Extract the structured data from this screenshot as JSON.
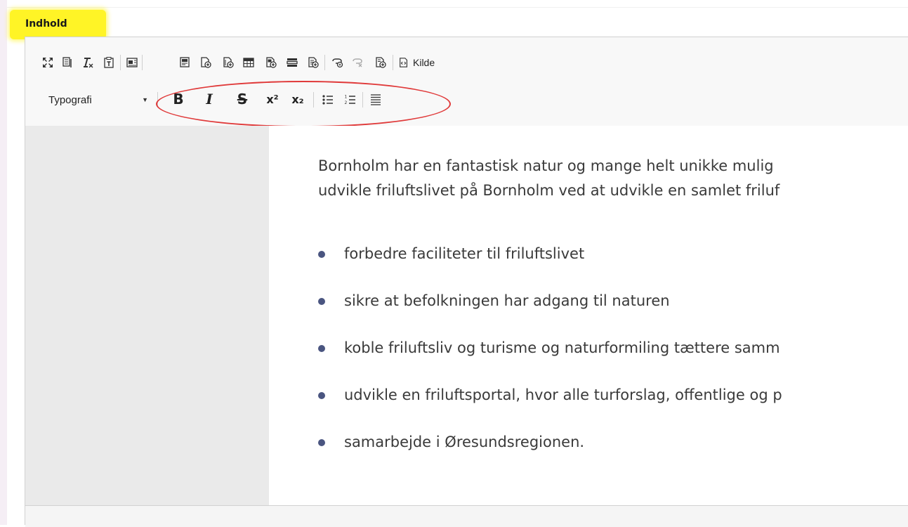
{
  "field_label": "Indhold",
  "toolbar": {
    "row1_icons": [
      "maximize-icon",
      "show-blocks-icon",
      "remove-format-icon",
      "paste-as-text-icon",
      "paste-from-word-icon",
      "insert-template-icon",
      "insert-image-icon",
      "insert-file-icon",
      "table-icon",
      "insert-media-icon",
      "horizontal-rule-icon",
      "insert-document-icon",
      "link-icon",
      "unlink-icon",
      "anchor-icon"
    ],
    "source_label": "Kilde",
    "format_combo": {
      "label": "Typografi"
    },
    "format_buttons": [
      {
        "name": "bold",
        "glyph": "B"
      },
      {
        "name": "italic",
        "glyph": "I"
      },
      {
        "name": "strike",
        "glyph": "S"
      },
      {
        "name": "superscript",
        "glyph": "x²"
      },
      {
        "name": "subscript",
        "glyph": "x₂"
      }
    ]
  },
  "annotation_color": "#e03a3a",
  "highlight_color": "#fff426",
  "content": {
    "intro_lines": [
      "Bornholm har en fantastisk natur og mange helt unikke mulig",
      "udvikle friluftslivet på Bornholm ved at udvikle en samlet friluf"
    ],
    "bullets": [
      "forbedre faciliteter til friluftslivet",
      "sikre at befolkningen har adgang til naturen",
      "koble friluftsliv og turisme og naturformiling tættere samm",
      "udvikle en friluftsportal, hvor alle turforslag, offentlige og p",
      "samarbejde i Øresundsregionen."
    ]
  }
}
